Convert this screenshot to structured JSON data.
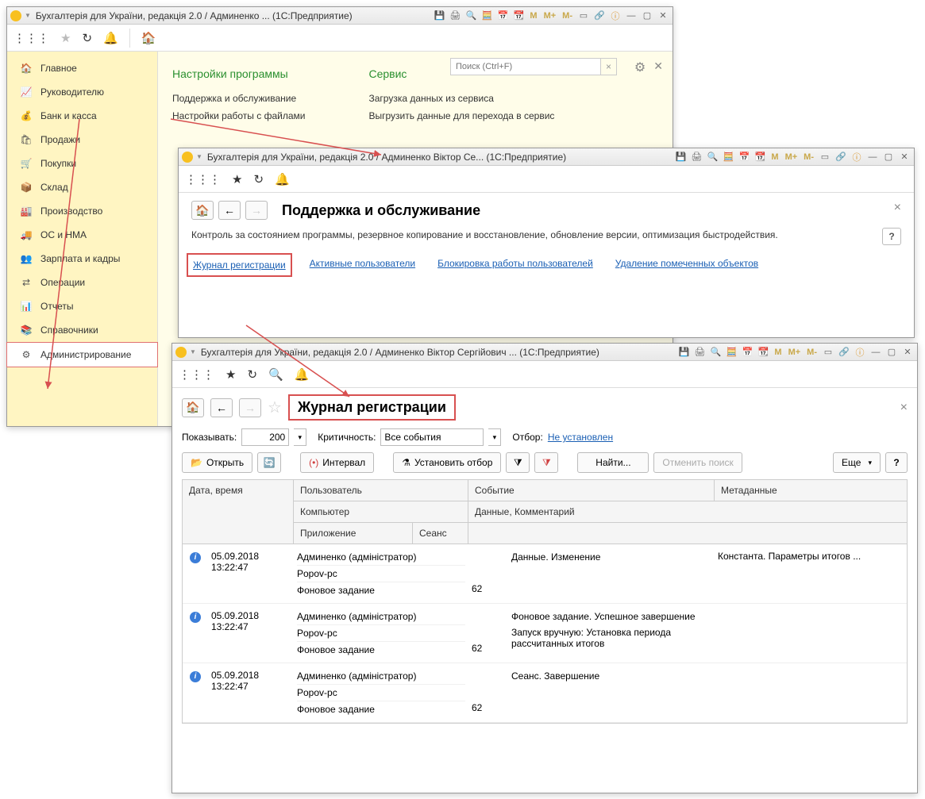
{
  "win1": {
    "title": "Бухгалтерія для України, редакція 2.0 / Админенко ...  (1С:Предприятие)",
    "sidebar": [
      {
        "icon": "🏠",
        "label": "Главное"
      },
      {
        "icon": "📈",
        "label": "Руководителю"
      },
      {
        "icon": "🏦",
        "label": "Банк и касса"
      },
      {
        "icon": "🛍",
        "label": "Продажи"
      },
      {
        "icon": "🛒",
        "label": "Покупки"
      },
      {
        "icon": "📦",
        "label": "Склад"
      },
      {
        "icon": "🏭",
        "label": "Производство"
      },
      {
        "icon": "🚚",
        "label": "ОС и НМА"
      },
      {
        "icon": "👥",
        "label": "Зарплата и кадры"
      },
      {
        "icon": "⚙",
        "label": "Операции"
      },
      {
        "icon": "📊",
        "label": "Отчеты"
      },
      {
        "icon": "📚",
        "label": "Справочники"
      },
      {
        "icon": "⚙",
        "label": "Администрирование"
      }
    ],
    "searchPlaceholder": "Поиск (Ctrl+F)",
    "col1head": "Настройки программы",
    "col2head": "Сервис",
    "col1": {
      "boxed": "Поддержка и обслуживание",
      "link2": "Настройки работы с файлами"
    },
    "col2": {
      "l1": "Загрузка данных из сервиса",
      "l2": "Выгрузить данные для перехода в сервис"
    }
  },
  "win2": {
    "title": "Бухгалтерія для України, редакція 2.0 / Админенко Віктор Се...  (1С:Предприятие)",
    "pageTitle": "Поддержка и обслуживание",
    "desc": "Контроль за состоянием программы, резервное копирование и восстановление, обновление версии, оптимизация быстродействия.",
    "links": {
      "l1": "Журнал регистрации",
      "l2": "Активные пользователи",
      "l3": "Блокировка работы пользователей",
      "l4": "Удаление помеченных объектов"
    }
  },
  "win3": {
    "title": "Бухгалтерія для України, редакція 2.0 / Админенко Віктор Сергійович ...  (1С:Предприятие)",
    "pageTitle": "Журнал регистрации",
    "filter": {
      "showLabel": "Показывать:",
      "showValue": "200",
      "critLabel": "Критичность:",
      "critValue": "Все события",
      "selLabel": "Отбор:",
      "selValue": "Не установлен"
    },
    "buttons": {
      "open": "Открыть",
      "interval": "Интервал",
      "setFilter": "Установить отбор",
      "find": "Найти...",
      "cancelFind": "Отменить поиск",
      "more": "Еще"
    },
    "headers": {
      "dateTime": "Дата, время",
      "user": "Пользователь",
      "event": "Событие",
      "meta": "Метаданные",
      "computer": "Компьютер",
      "dataComment": "Данные, Комментарий",
      "app": "Приложение",
      "session": "Сеанс"
    },
    "rows": [
      {
        "date": "05.09.2018",
        "time": "13:22:47",
        "user": "Админенко (адміністратор)",
        "comp": "Popov-pc",
        "app": "Фоновое задание",
        "sess": "62",
        "event": "Данные. Изменение",
        "data": "",
        "meta": "Константа. Параметры итогов ..."
      },
      {
        "date": "05.09.2018",
        "time": "13:22:47",
        "user": "Админенко (адміністратор)",
        "comp": "Popov-pc",
        "app": "Фоновое задание",
        "sess": "62",
        "event": "Фоновое задание. Успешное завершение",
        "data": "Запуск вручную: Установка периода рассчитанных итогов",
        "meta": ""
      },
      {
        "date": "05.09.2018",
        "time": "13:22:47",
        "user": "Админенко (адміністратор)",
        "comp": "Popov-pc",
        "app": "Фоновое задание",
        "sess": "62",
        "event": "Сеанс. Завершение",
        "data": "",
        "meta": ""
      }
    ]
  },
  "titleIcons": {
    "m": "M",
    "mp": "M+",
    "mm": "M-"
  }
}
